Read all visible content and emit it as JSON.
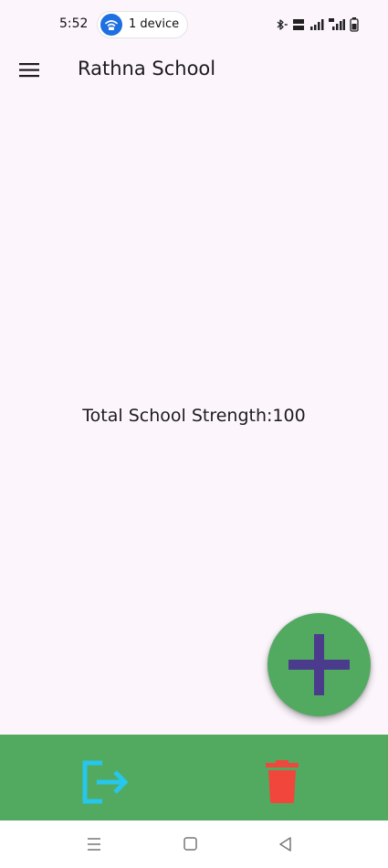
{
  "status_bar": {
    "time": "5:52",
    "hotspot_label": "1 device",
    "icons": [
      "hotspot-icon",
      "bluetooth-icon",
      "volte-icon",
      "signal-icon",
      "5g-signal-icon",
      "battery-icon"
    ]
  },
  "app_bar": {
    "title": "Rathna School",
    "menu_icon": "hamburger-menu-icon"
  },
  "main": {
    "strength_text": "Total School Strength:100"
  },
  "fab": {
    "icon": "plus-icon"
  },
  "bottom_bar": {
    "logout_icon": "logout-icon",
    "delete_icon": "trash-icon"
  },
  "nav_bar": {
    "icons": [
      "menu-lines-icon",
      "home-square-icon",
      "back-triangle-icon"
    ]
  },
  "colors": {
    "background": "#FCF6FC",
    "primary_green": "#52AA61",
    "fab_plus": "#4A3B8C",
    "logout_cyan": "#27C6EC",
    "delete_red": "#F0463C",
    "hotspot_blue": "#1E6FE0"
  }
}
